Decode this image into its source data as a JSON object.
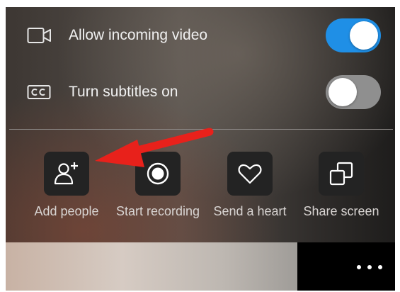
{
  "settings": {
    "video": {
      "label": "Allow incoming video",
      "enabled": true,
      "icon": "video-camera-icon"
    },
    "subtitles": {
      "label": "Turn subtitles on",
      "enabled": false,
      "icon": "closed-captions-icon"
    }
  },
  "actions": [
    {
      "label": "Add people",
      "icon": "add-person-icon"
    },
    {
      "label": "Start recording",
      "icon": "record-icon"
    },
    {
      "label": "Send a heart",
      "icon": "heart-icon"
    },
    {
      "label": "Share screen",
      "icon": "share-screen-icon"
    }
  ],
  "more_menu": {
    "icon": "more-dots-icon"
  },
  "annotation": {
    "icon": "red-arrow-icon",
    "color": "#e8211b"
  },
  "colors": {
    "toggle_on": "#1f8fe6",
    "toggle_off": "#8f8f8f"
  }
}
